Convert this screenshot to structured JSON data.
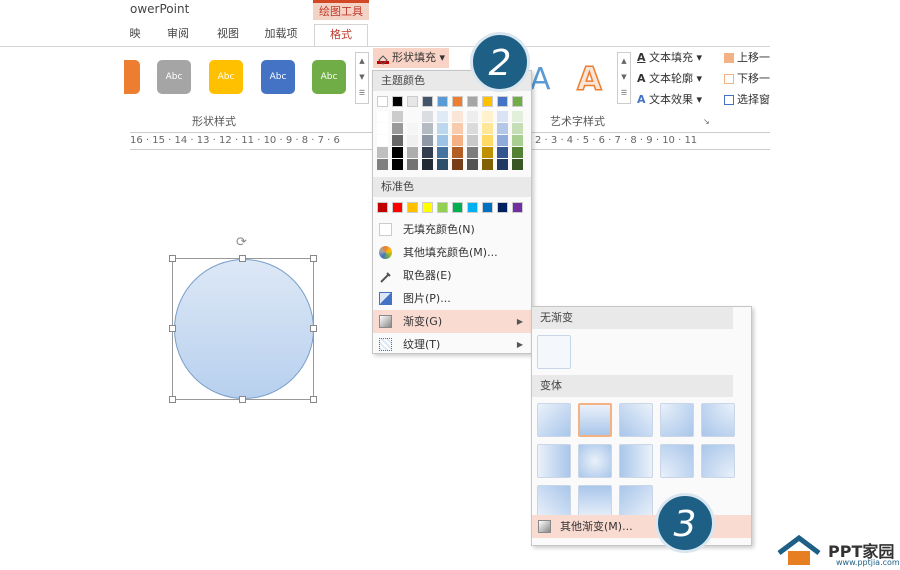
{
  "app": {
    "title": "owerPoint",
    "context_tab": "绘图工具"
  },
  "tabs": [
    {
      "label": "映"
    },
    {
      "label": "审阅"
    },
    {
      "label": "视图"
    },
    {
      "label": "加载项"
    },
    {
      "label": "格式"
    }
  ],
  "shape_styles": {
    "group_label": "形状样式",
    "buttons": [
      {
        "label": "",
        "color": "#ed7d31"
      },
      {
        "label": "Abc",
        "color": "#a5a5a5"
      },
      {
        "label": "Abc",
        "color": "#ffc000"
      },
      {
        "label": "Abc",
        "color": "#4472c4"
      },
      {
        "label": "Abc",
        "color": "#70ad47"
      }
    ]
  },
  "shape_fill": {
    "label": "形状填充"
  },
  "wordart": {
    "group_label": "艺术字样式",
    "text_fill": "文本填充",
    "text_outline": "文本轮廓",
    "text_effects": "文本效果"
  },
  "arrange": {
    "bring_forward": "上移一",
    "send_backward": "下移一",
    "selection_pane": "选择窗"
  },
  "ruler": {
    "left": "16 · 15 · 14 · 13 · 12 · 11 · 10 · 9 · 8 · 7 · 6",
    "right": "2 · 3 · 4 · 5 · 6 · 7 · 8 · 9 · 10 · 11"
  },
  "menu": {
    "theme_colors_label": "主题颜色",
    "theme_colors": [
      "#ffffff",
      "#000000",
      "#e7e6e6",
      "#44546a",
      "#5b9bd5",
      "#ed7d31",
      "#a5a5a5",
      "#ffc000",
      "#4472c4",
      "#70ad47"
    ],
    "standard_colors_label": "标准色",
    "standard_colors": [
      "#c00000",
      "#ff0000",
      "#ffc000",
      "#ffff00",
      "#92d050",
      "#00b050",
      "#00b0f0",
      "#0070c0",
      "#002060",
      "#7030a0"
    ],
    "no_fill": "无填充颜色(N)",
    "more_colors": "其他填充颜色(M)...",
    "eyedropper": "取色器(E)",
    "picture": "图片(P)...",
    "gradient": "渐变(G)",
    "texture": "纹理(T)"
  },
  "gradient_submenu": {
    "no_gradient": "无渐变",
    "variants": "变体",
    "more": "其他渐变(M)..."
  },
  "badges": [
    "2",
    "3"
  ],
  "logo": {
    "name": "PPT家园",
    "url": "www.pptjia.com"
  }
}
